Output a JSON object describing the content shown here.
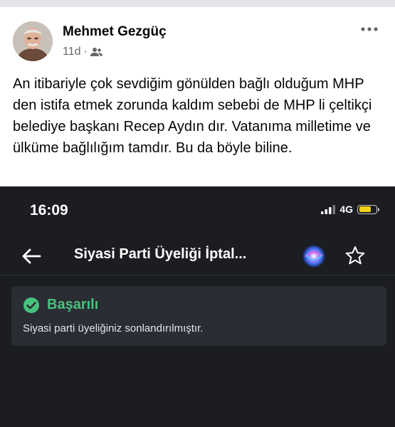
{
  "post": {
    "author": "Mehmet Gezgüç",
    "time": "11d",
    "separator": "·",
    "audience_icon": "friends-icon",
    "more_icon": "more-horizontal-icon",
    "text": "An itibariyle çok sevdiğim gönülden bağlı olduğum MHP den istifa etmek zorunda kaldım sebebi de MHP li çeltikçi belediye başkanı Recep Aydın dır. Vatanıma milletime ve ülküme bağlılığım tamdır. Bu da böyle biline."
  },
  "screenshot": {
    "status_bar": {
      "time": "16:09",
      "network": "4G",
      "battery_color": "#f2d11c"
    },
    "app_bar": {
      "back_icon": "arrow-left-icon",
      "title": "Siyasi Parti Üyeliği İptal...",
      "assistant_icon": "assistant-orb-icon",
      "favorite_icon": "star-icon"
    },
    "alert": {
      "icon": "check-circle-icon",
      "title": "Başarılı",
      "message": "Siyasi parti üyeliğiniz sonlandırılmıştır.",
      "color": "#47c27e"
    }
  }
}
